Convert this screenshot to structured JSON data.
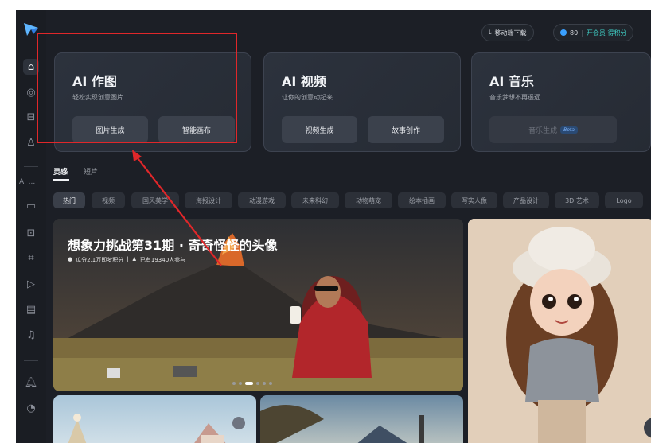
{
  "top": {
    "download_label": "移动端下载",
    "points": "80",
    "vip_label": "开会员 得积分"
  },
  "sidebar": {
    "ai_label": "AI ..."
  },
  "cards": [
    {
      "title": "AI 作图",
      "subtitle": "轻松实现创意图片",
      "buttons": [
        "图片生成",
        "智能画布"
      ]
    },
    {
      "title": "AI 视频",
      "subtitle": "让你的创意动起来",
      "buttons": [
        "视频生成",
        "故事创作"
      ]
    },
    {
      "title": "AI 音乐",
      "subtitle": "音乐梦想不再遥远",
      "buttons": [
        "音乐生成"
      ],
      "badge": "Beta"
    }
  ],
  "tabs": [
    "灵感",
    "短片"
  ],
  "chips": [
    "热门",
    "视频",
    "国风美学",
    "海报设计",
    "动漫游戏",
    "未来科幻",
    "动物萌宠",
    "绘本插画",
    "写实人像",
    "产品设计",
    "3D 艺术",
    "Logo"
  ],
  "banner": {
    "title": "想象力挑战第31期 · 奇奇怪怪的头像",
    "reward": "瓜分2.1万即梦积分",
    "participants": "已有19340人参与"
  },
  "colors": {
    "accent": "#3aa0ff",
    "vip": "#3fd0c7",
    "highlight": "#e0272a"
  }
}
